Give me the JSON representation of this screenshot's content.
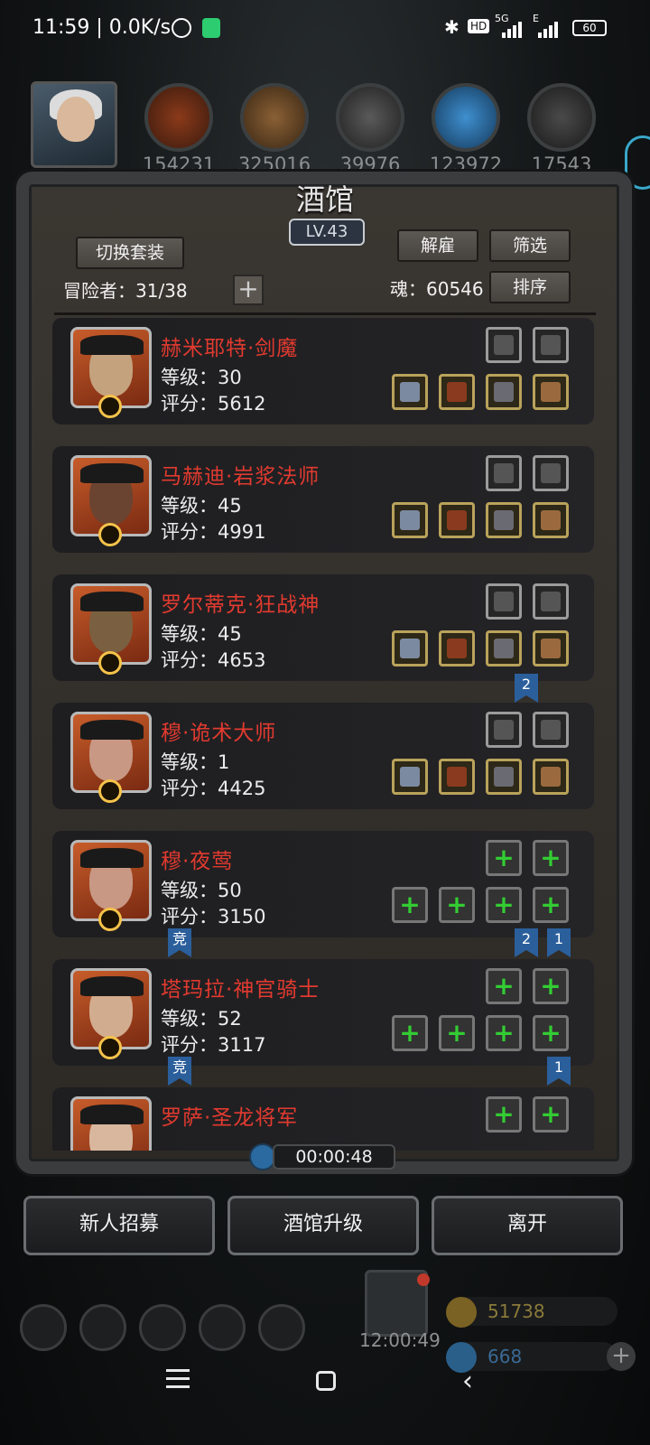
{
  "status_bar": {
    "time_speed": "11:59 | 0.0K/s",
    "hd": "HD",
    "net1": "5G",
    "net2": "E",
    "battery": "60"
  },
  "resources": [
    "154231",
    "325016",
    "39976",
    "123972",
    "17543"
  ],
  "panel": {
    "title": "酒馆",
    "level": "LV.43",
    "switch_outfit": "切换套装",
    "dismiss": "解雇",
    "filter": "筛选",
    "sort": "排序",
    "adventurers": "冒险者：31/38",
    "soul": "魂：60546"
  },
  "heroes": [
    {
      "name": "赫米耶特·剑魔",
      "level": "等级：30",
      "score": "评分：5612",
      "portrait_color": "#c4a27e",
      "top_slots": [
        "grey",
        "grey"
      ],
      "bottom_slots": [
        "gold",
        "gold",
        "gold",
        "gold"
      ]
    },
    {
      "name": "马赫迪·岩浆法师",
      "level": "等级：45",
      "score": "评分：4991",
      "portrait_color": "#6b4331",
      "top_slots": [
        "grey",
        "grey"
      ],
      "bottom_slots": [
        "gold",
        "gold",
        "gold",
        "gold"
      ]
    },
    {
      "name": "罗尔蒂克·狂战神",
      "level": "等级：45",
      "score": "评分：4653",
      "portrait_color": "#7a6040",
      "top_slots": [
        "grey",
        "grey"
      ],
      "bottom_slots": [
        "gold",
        "gold",
        "gold",
        "gold"
      ]
    },
    {
      "name": "穆·诡术大师",
      "level": "等级：1",
      "score": "评分：4425",
      "portrait_color": "#c89884",
      "top_slots": [
        "grey",
        "grey"
      ],
      "bottom_slots": [
        "gold",
        "gold",
        "gold",
        "gold"
      ]
    },
    {
      "name": "穆·夜莺",
      "level": "等级：50",
      "score": "评分：3150",
      "portrait_color": "#c89884",
      "top_slots": [
        "empty",
        "empty"
      ],
      "bottom_slots": [
        "empty",
        "empty",
        "empty",
        "empty"
      ]
    },
    {
      "name": "塔玛拉·神官骑士",
      "level": "等级：52",
      "score": "评分：3117",
      "portrait_color": "#d2ac8e",
      "top_slots": [
        "empty",
        "empty"
      ],
      "bottom_slots": [
        "empty",
        "empty",
        "empty",
        "empty"
      ]
    },
    {
      "name": "罗萨·圣龙将军",
      "level": "",
      "score": "",
      "portrait_color": "#d8b79e",
      "top_slots": [
        "empty",
        "empty"
      ],
      "bottom_slots": []
    }
  ],
  "ribbons": {
    "r1": "2",
    "r2": "竞",
    "r3": "2",
    "r4": "1",
    "r5": "竞",
    "r6": "1"
  },
  "timer": "00:00:48",
  "bottom_buttons": {
    "recruit": "新人招募",
    "upgrade": "酒馆升级",
    "leave": "离开"
  },
  "footer": {
    "gift_time": "12:00:49",
    "gold": "51738",
    "gem": "668"
  },
  "colors": {
    "hero_name": "#e23a2f",
    "plus_green": "#33cc33",
    "ribbon_blue": "#2b5f9c"
  }
}
